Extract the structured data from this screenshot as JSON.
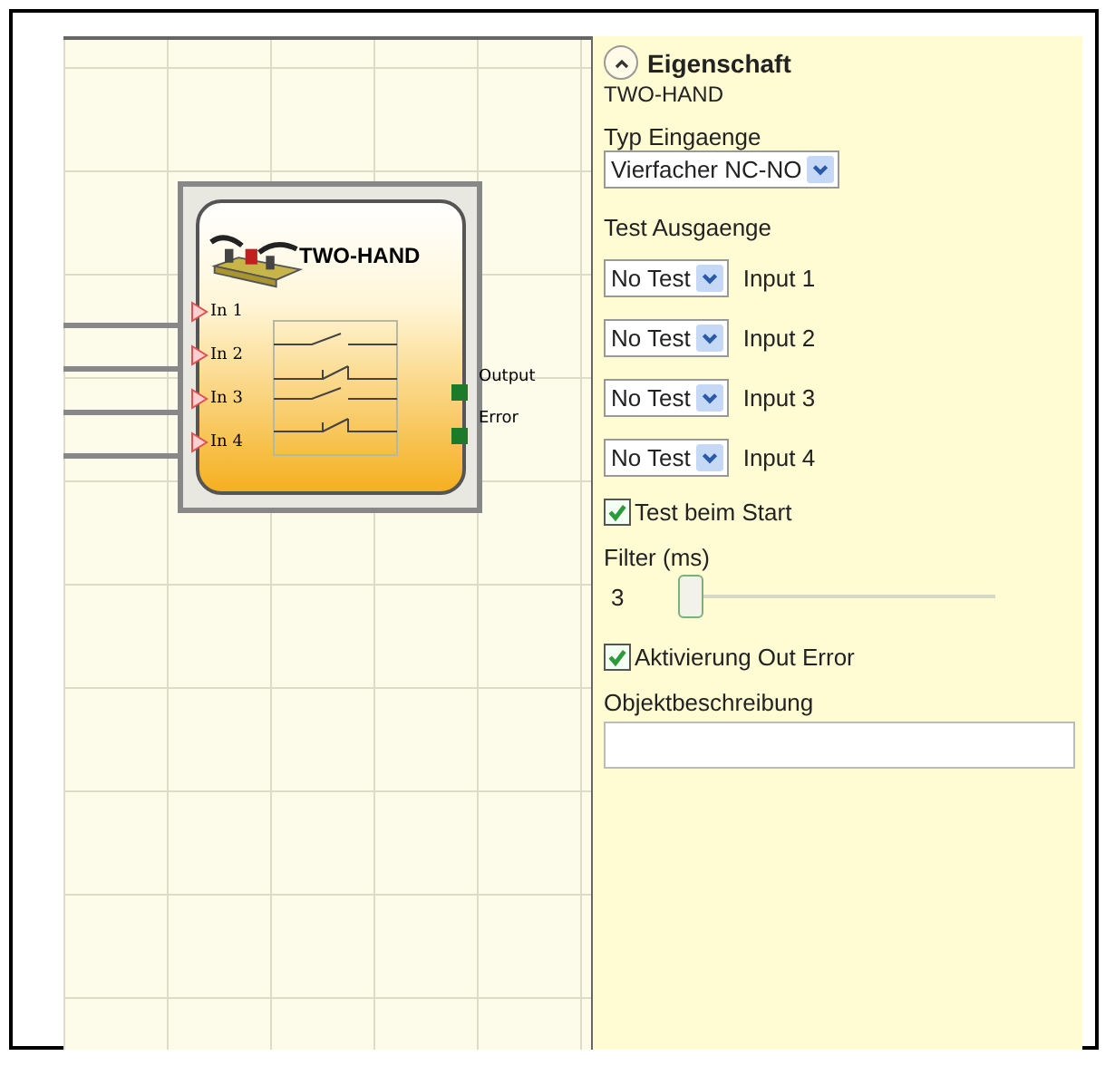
{
  "canvas": {
    "block": {
      "title": "TWO-HAND",
      "inputs": [
        "In 1",
        "In 2",
        "In 3",
        "In 4"
      ],
      "outputs": [
        "Output",
        "Error"
      ]
    }
  },
  "panel": {
    "header": {
      "title": "Eigenschaft",
      "expanded": true
    },
    "subtitle": "TWO-HAND",
    "input_type": {
      "label": "Typ Eingaenge",
      "value": "Vierfacher NC-NO"
    },
    "test_outputs": {
      "label": "Test Ausgaenge",
      "rows": [
        {
          "value": "No Test",
          "label": "Input 1"
        },
        {
          "value": "No Test",
          "label": "Input 2"
        },
        {
          "value": "No Test",
          "label": "Input 3"
        },
        {
          "value": "No Test",
          "label": "Input 4"
        }
      ]
    },
    "test_at_start": {
      "label": "Test beim Start",
      "checked": true
    },
    "filter": {
      "label": "Filter (ms)",
      "reading": "3",
      "level": 0
    },
    "out_error": {
      "label": "Aktivierung Out Error",
      "checked": true
    },
    "description": {
      "label": "Objektbeschreibung"
    }
  }
}
